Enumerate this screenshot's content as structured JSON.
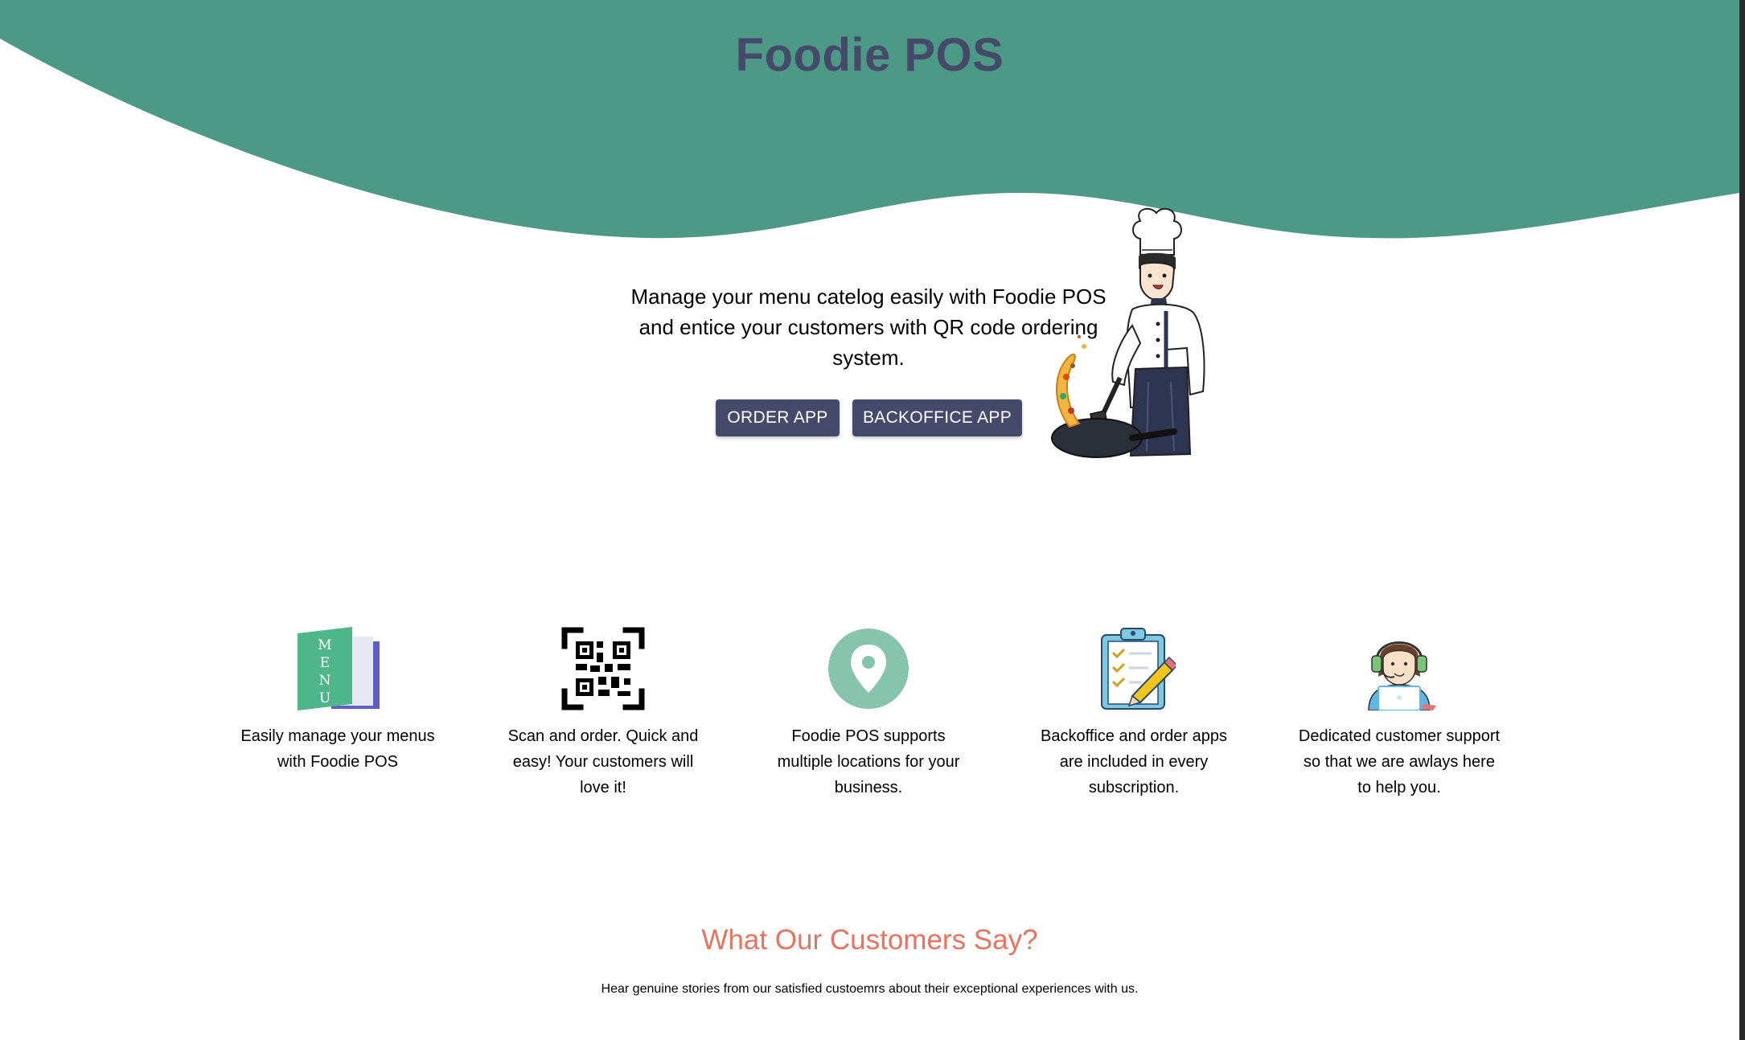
{
  "header": {
    "title": "Foodie POS",
    "wave_color": "#4c9a85",
    "title_color": "#454a6b"
  },
  "hero": {
    "text": "Manage your menu catelog easily with Foodie POS and entice your customers with QR code ordering system.",
    "order_app_label": "ORDER APP",
    "backoffice_app_label": "BACKOFFICE APP",
    "button_color": "#454a6b",
    "illustration": "chef-icon"
  },
  "features": [
    {
      "icon": "menu-book-icon",
      "text": "Easily manage your menus with Foodie POS"
    },
    {
      "icon": "qr-code-icon",
      "text": "Scan and order. Quick and easy! Your customers will love it!"
    },
    {
      "icon": "location-pin-icon",
      "text": "Foodie POS supports multiple locations for your business."
    },
    {
      "icon": "clipboard-checklist-icon",
      "text": "Backoffice and order apps are included in every subscription."
    },
    {
      "icon": "customer-support-icon",
      "text": "Dedicated customer support so that we are awlays here to help you."
    }
  ],
  "menu_icon_letters": [
    "M",
    "E",
    "N",
    "U"
  ],
  "testimonials": {
    "title": "What Our Customers Say?",
    "subtitle": "Hear genuine stories from our satisfied custoemrs about their exceptional experiences with us.",
    "title_color": "#e8735f"
  }
}
